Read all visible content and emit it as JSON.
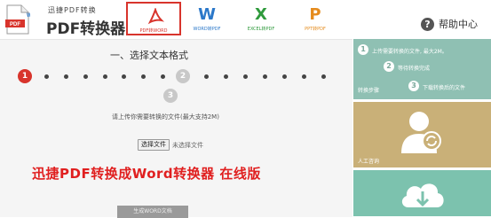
{
  "header": {
    "logo_small_text": "迅捷PDF转换",
    "logo_big_text": "PDF转换器",
    "logo_badge_text": "PDF",
    "tabs": [
      {
        "label": "PDF转WORD",
        "icon": "pdf-icon",
        "active": true
      },
      {
        "label": "WORD转PDF",
        "icon": "word-icon",
        "glyph": "W",
        "active": false
      },
      {
        "label": "EXCEL转PDF",
        "icon": "excel-icon",
        "glyph": "X",
        "active": false
      },
      {
        "label": "PPT转PDF",
        "icon": "ppt-icon",
        "glyph": "P",
        "active": false
      }
    ],
    "help_label": "帮助中心",
    "help_glyph": "?"
  },
  "main": {
    "title": "一、选择文本格式",
    "steps": {
      "step1": "1",
      "step2": "2",
      "step3": "3"
    },
    "hint": "请上传你需要转换的文件(最大支持2M)",
    "choose_file_label": "选择文件",
    "file_status": "未选择文件",
    "promo_text": "迅捷PDF转换成Word转换器 在线版",
    "generate_label": "生成WORD文档"
  },
  "side": {
    "steps": [
      {
        "num": "1",
        "text": "上传需要转换的文件, 最大2M。"
      },
      {
        "num": "2",
        "text": "等待转换完成"
      },
      {
        "num": "3",
        "text": "下载转换后的文件"
      }
    ],
    "steps_caption": "转换步骤",
    "support_caption": "人工咨询"
  },
  "colors": {
    "accent": "#d8342c",
    "word": "#2b78c9",
    "excel": "#2f9a3c",
    "ppt": "#e58b1d",
    "side_card_1": "#8fc0b3",
    "side_card_2": "#c9b078",
    "side_card_3": "#7cc2ae"
  }
}
